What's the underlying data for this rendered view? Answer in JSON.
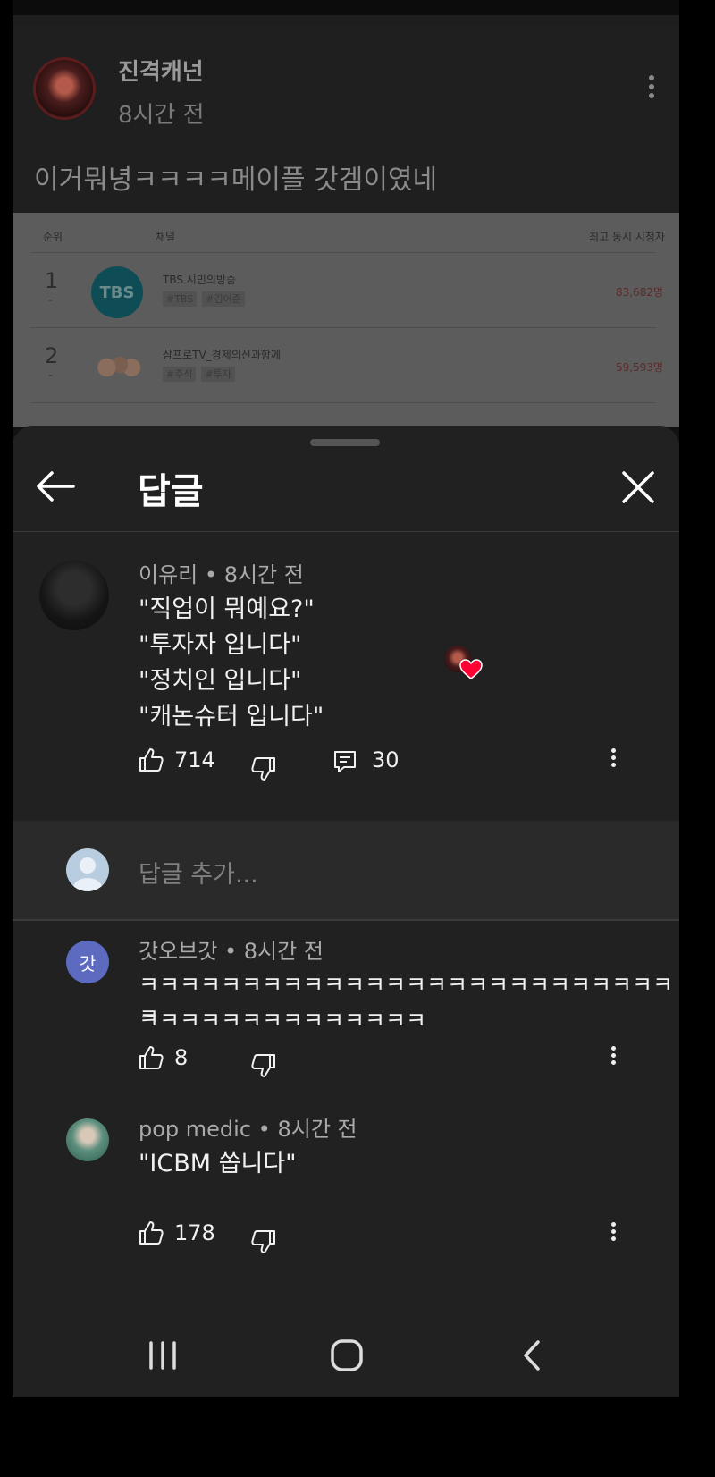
{
  "background_post": {
    "author": "진격캐넌",
    "time": "8시간 전",
    "text": "이거뭐녕ㅋㅋㅋㅋ메이플 갓겜이였네",
    "ranking_image": {
      "col_rank": "순위",
      "col_channel": "채널",
      "col_viewers": "최고 동시 시청자",
      "rows": [
        {
          "rank": "1",
          "change": "-",
          "logo": "TBS",
          "name": "TBS 시민의방송",
          "tags": [
            "#TBS",
            "#김어준"
          ],
          "viewers": "83,682명"
        },
        {
          "rank": "2",
          "change": "-",
          "logo": "",
          "name": "삼프로TV_경제의신과함께",
          "tags": [
            "#주식",
            "#투자"
          ],
          "viewers": "59,593명"
        }
      ]
    }
  },
  "sheet": {
    "title": "답글",
    "back_icon": "arrow-left-icon",
    "close_icon": "close-icon"
  },
  "parent_comment": {
    "author": "이유리",
    "time": "8시간 전",
    "lines": [
      "\"직업이 뭐예요?\"",
      "\"투자자 입니다\"",
      "\"정치인 입니다\"",
      "\"캐논슈터 입니다\""
    ],
    "likes": "714",
    "replies": "30"
  },
  "add_reply": {
    "placeholder": "답글 추가..."
  },
  "replies": [
    {
      "avatar_letter": "갓",
      "author": "갓오브갓",
      "time": "8시간 전",
      "lines": [
        "ㅋㅋㅋㅋㅋㅋㅋㅋㅋㅋㅋㅋㅋㅋㅋㅋㅋㅋㅋㅋㅋㅋㅋㅋㅋㅋㅋ",
        "ㅋㅋㅋㅋㅋㅋㅋㅋㅋㅋㅋㅋㅋㅋ"
      ],
      "likes": "8"
    },
    {
      "author": "pop medic",
      "time": "8시간 전",
      "lines": [
        "\"ICBM 쏩니다\""
      ],
      "likes": "178"
    }
  ],
  "separator": "•",
  "colors": {
    "heart": "#ff0033",
    "sheet_bg": "#212121",
    "got_avatar": "#5c6bc0"
  }
}
